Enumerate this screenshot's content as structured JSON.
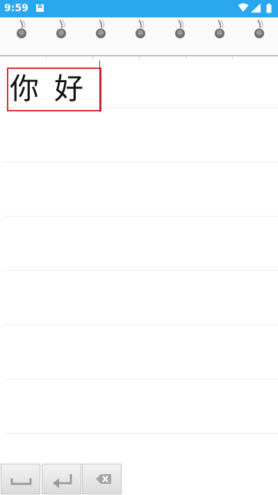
{
  "status_bar": {
    "time": "9:59",
    "notification_glyph": "A",
    "icons": [
      "notification-icon",
      "wifi-icon",
      "signal-icon",
      "battery-icon"
    ],
    "background_color": "#29a8f0"
  },
  "notebook": {
    "handwritten_text": [
      "你",
      "好"
    ],
    "selection_color": "#d9262a",
    "ring_count": 7
  },
  "toolbar": {
    "buttons": [
      "space-icon",
      "enter-icon",
      "backspace-icon"
    ]
  }
}
